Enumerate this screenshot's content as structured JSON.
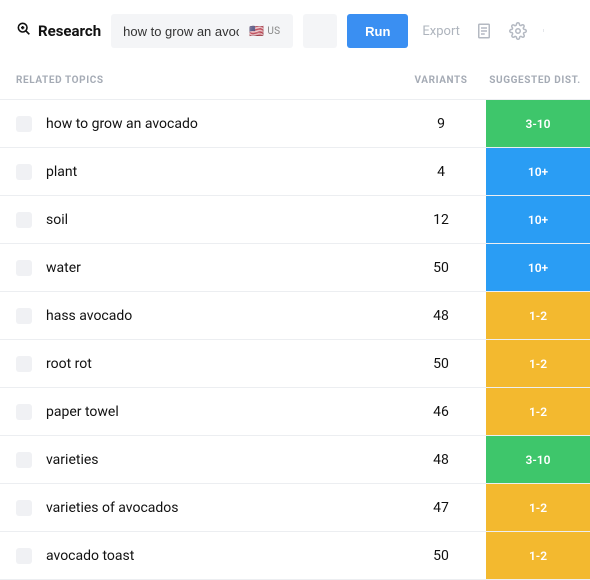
{
  "header": {
    "brand": "Research",
    "search_value": "how to grow an avocado",
    "locale_label": "US",
    "run_label": "Run",
    "export_label": "Export"
  },
  "columns": {
    "topics": "Related Topics",
    "variants": "Variants",
    "dist": "Suggested Dist."
  },
  "dist_colors": {
    "green": "#3ec66b",
    "blue": "#2a9df4",
    "yellow": "#f3b92f"
  },
  "rows": [
    {
      "topic": "how to grow an avocado",
      "variants": "9",
      "dist": "3-10",
      "dist_class": "dist-green"
    },
    {
      "topic": "plant",
      "variants": "4",
      "dist": "10+",
      "dist_class": "dist-blue"
    },
    {
      "topic": "soil",
      "variants": "12",
      "dist": "10+",
      "dist_class": "dist-blue"
    },
    {
      "topic": "water",
      "variants": "50",
      "dist": "10+",
      "dist_class": "dist-blue"
    },
    {
      "topic": "hass avocado",
      "variants": "48",
      "dist": "1-2",
      "dist_class": "dist-yellow"
    },
    {
      "topic": "root rot",
      "variants": "50",
      "dist": "1-2",
      "dist_class": "dist-yellow"
    },
    {
      "topic": "paper towel",
      "variants": "46",
      "dist": "1-2",
      "dist_class": "dist-yellow"
    },
    {
      "topic": "varieties",
      "variants": "48",
      "dist": "3-10",
      "dist_class": "dist-green"
    },
    {
      "topic": "varieties of avocados",
      "variants": "47",
      "dist": "1-2",
      "dist_class": "dist-yellow"
    },
    {
      "topic": "avocado toast",
      "variants": "50",
      "dist": "1-2",
      "dist_class": "dist-yellow"
    }
  ]
}
